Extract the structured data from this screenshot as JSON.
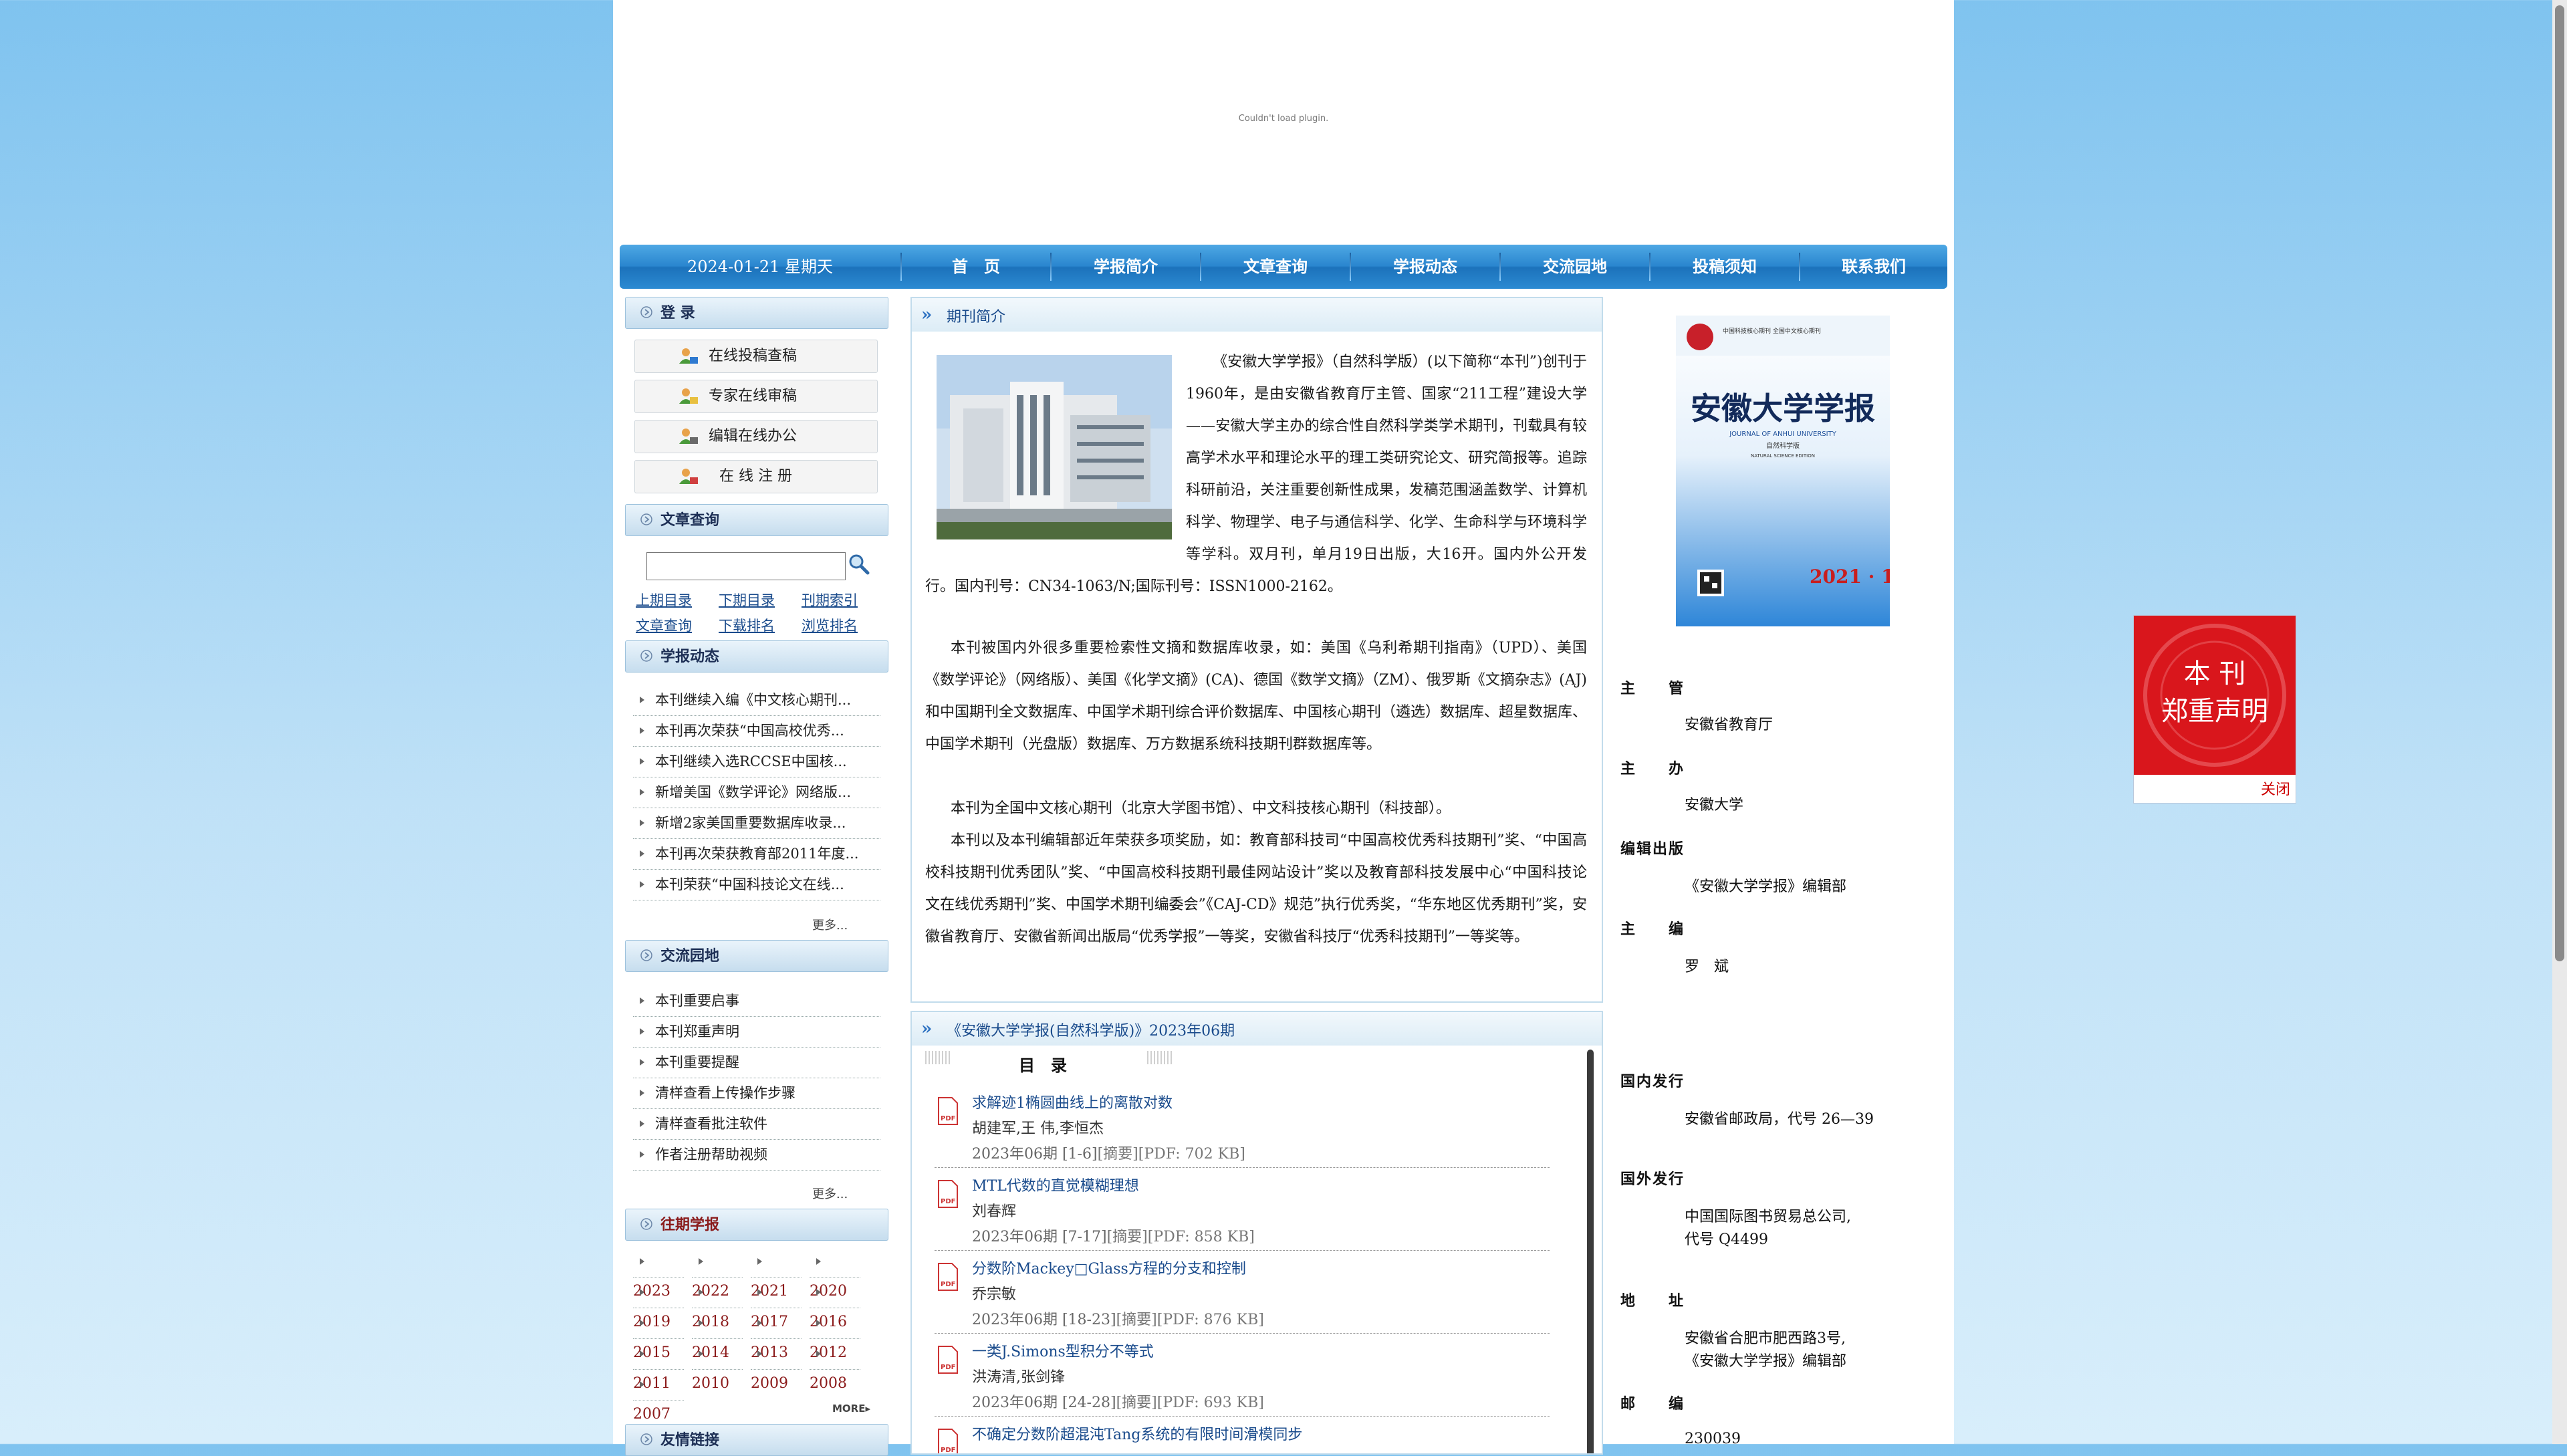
{
  "banner": {
    "plugin_message": "Couldn't load plugin."
  },
  "nav": {
    "date": "2024-01-21 星期天",
    "items": [
      "首　页",
      "学报简介",
      "文章查询",
      "学报动态",
      "交流园地",
      "投稿须知",
      "联系我们"
    ]
  },
  "login": {
    "heading": "登 录",
    "buttons": [
      "在线投稿查稿",
      "专家在线审稿",
      "编辑在线办公",
      "在 线 注 册"
    ]
  },
  "article_search": {
    "heading": "文章查询",
    "search_value": "",
    "links": [
      "上期目录",
      "下期目录",
      "刊期索引",
      "文章查询",
      "下载排名",
      "浏览排名"
    ]
  },
  "news": {
    "heading": "学报动态",
    "items": [
      "本刊继续入编《中文核心期刊...",
      "本刊再次荣获“中国高校优秀...",
      "本刊继续入选RCCSE中国核...",
      "新增美国《数学评论》网络版...",
      "新增2家美国重要数据库收录...",
      "本刊再次荣获教育部2011年度...",
      "本刊荣获“中国科技论文在线..."
    ],
    "more": "更多..."
  },
  "forum": {
    "heading": "交流园地",
    "items": [
      "本刊重要启事",
      "本刊郑重声明",
      "本刊重要提醒",
      "清样查看上传操作步骤",
      "清样查看批注软件",
      "作者注册帮助视频"
    ],
    "more": "更多..."
  },
  "archive": {
    "heading": "往期学报",
    "years": [
      "2023",
      "2022",
      "2021",
      "2020",
      "2019",
      "2018",
      "2017",
      "2016",
      "2015",
      "2014",
      "2013",
      "2012",
      "2011",
      "2010",
      "2009",
      "2008",
      "2007"
    ],
    "more": "MORE▸"
  },
  "links_section": {
    "heading": "友情链接"
  },
  "intro": {
    "heading": "期刊简介",
    "lead": "《安徽大学学报》（自然科学版）(以下简称“本刊”)创刊于1960年，是由安徽省教育厅主管、国家“211工程”建设大学——安徽大学主办的综合性自然科学类学术期刊，刊载具有较高学术水平和理论水平的理工类研究论文、研究简报等。追踪科研前沿，关注重要创新性成果，发稿范围涵盖数学、计算机科学、物理学、电子与通信科学、化学、生命科学与环境科学等学科。双月刊，单月19日出版，大16开。国内外公开发行。国内刊号：CN34-1063/N;国际刊号：ISSN1000-2162。",
    "p2": "本刊被国内外很多重要检索性文摘和数据库收录，如：美国《乌利希期刊指南》（UPD）、美国《数学评论》（网络版）、美国《化学文摘》(CA)、德国《数学文摘》（ZM）、俄罗斯《文摘杂志》(AJ)和中国期刊全文数据库、中国学术期刊综合评价数据库、中国核心期刊（遴选）数据库、超星数据库、中国学术期刊（光盘版）数据库、万方数据系统科技期刊群数据库等。",
    "p3": "本刊为全国中文核心期刊（北京大学图书馆）、中文科技核心期刊（科技部）。",
    "p4": "本刊以及本刊编辑部近年荣获多项奖励，如：教育部科技司“中国高校优秀科技期刊”奖、“中国高校科技期刊优秀团队”奖、“中国高校科技期刊最佳网站设计”奖以及教育部科技发展中心“中国科技论文在线优秀期刊”奖、中国学术期刊编委会”《CAJ-CD》规范”执行优秀奖，“华东地区优秀期刊”奖，安徽省教育厅、安徽省新闻出版局“优秀学报”一等奖，安徽省科技厅“优秀科技期刊”一等奖等。"
  },
  "issue": {
    "heading": "《安徽大学学报(自然科学版)》2023年06期",
    "toc_label": "目　录",
    "articles": [
      {
        "title": "求解迹1椭圆曲线上的离散对数",
        "authors": "胡建军,王 伟,李恒杰",
        "issue": "2023年06期 [1-6]",
        "abstract": "[摘要]",
        "pdf": "[PDF: 702 KB]"
      },
      {
        "title": "MTL代数的直觉模糊理想",
        "authors": "刘春辉",
        "issue": "2023年06期 [7-17]",
        "abstract": "[摘要]",
        "pdf": "[PDF: 858 KB]"
      },
      {
        "title": "分数阶Mackey□Glass方程的分支和控制",
        "authors": "乔宗敏",
        "issue": "2023年06期 [18-23]",
        "abstract": "[摘要]",
        "pdf": "[PDF: 876 KB]"
      },
      {
        "title": "一类J.Simons型积分不等式",
        "authors": "洪涛清,张剑锋",
        "issue": "2023年06期 [24-28]",
        "abstract": "[摘要]",
        "pdf": "[PDF: 693 KB]"
      },
      {
        "title": "不确定分数阶超混沌Tang系统的有限时间滑模同步",
        "authors": "",
        "issue": "",
        "abstract": "",
        "pdf": ""
      }
    ]
  },
  "cover": {
    "title": "安徽大学学报",
    "subtitle": "JOURNAL OF ANHUI UNIVERSITY",
    "edition": "自然科学版",
    "edition_en": "NATURAL SCIENCE EDITION",
    "year_issue": "2021 · 1",
    "top_text": "中国科技核心期刊 全国中文核心期刊"
  },
  "journal_info": {
    "supervisor_label": "主　　管",
    "supervisor": "安徽省教育厅",
    "sponsor_label": "主　　办",
    "sponsor": "安徽大学",
    "publisher_label": "编辑出版",
    "publisher": "《安徽大学学报》编辑部",
    "editor_label": "主　　编",
    "editor": "罗　斌",
    "domestic_label": "国内发行",
    "domestic": "安徽省邮政局，代号 26—39",
    "foreign_label": "国外发行",
    "foreign_1": "中国国际图书贸易总公司,",
    "foreign_2": "代号 Q4499",
    "address_label": "地　　址",
    "address_1": "安徽省合肥市肥西路3号,",
    "address_2": "《安徽大学学报》编辑部",
    "postcode_label": "邮　　编",
    "postcode": "230039"
  },
  "notice": {
    "line1": "本 刊",
    "line2": "郑重声明",
    "close": "关闭"
  },
  "colors": {
    "nav": "#2a86cf",
    "link": "#1a4b8c",
    "accent_red": "#d81e1e",
    "page_bg": "#7fc3ef"
  }
}
